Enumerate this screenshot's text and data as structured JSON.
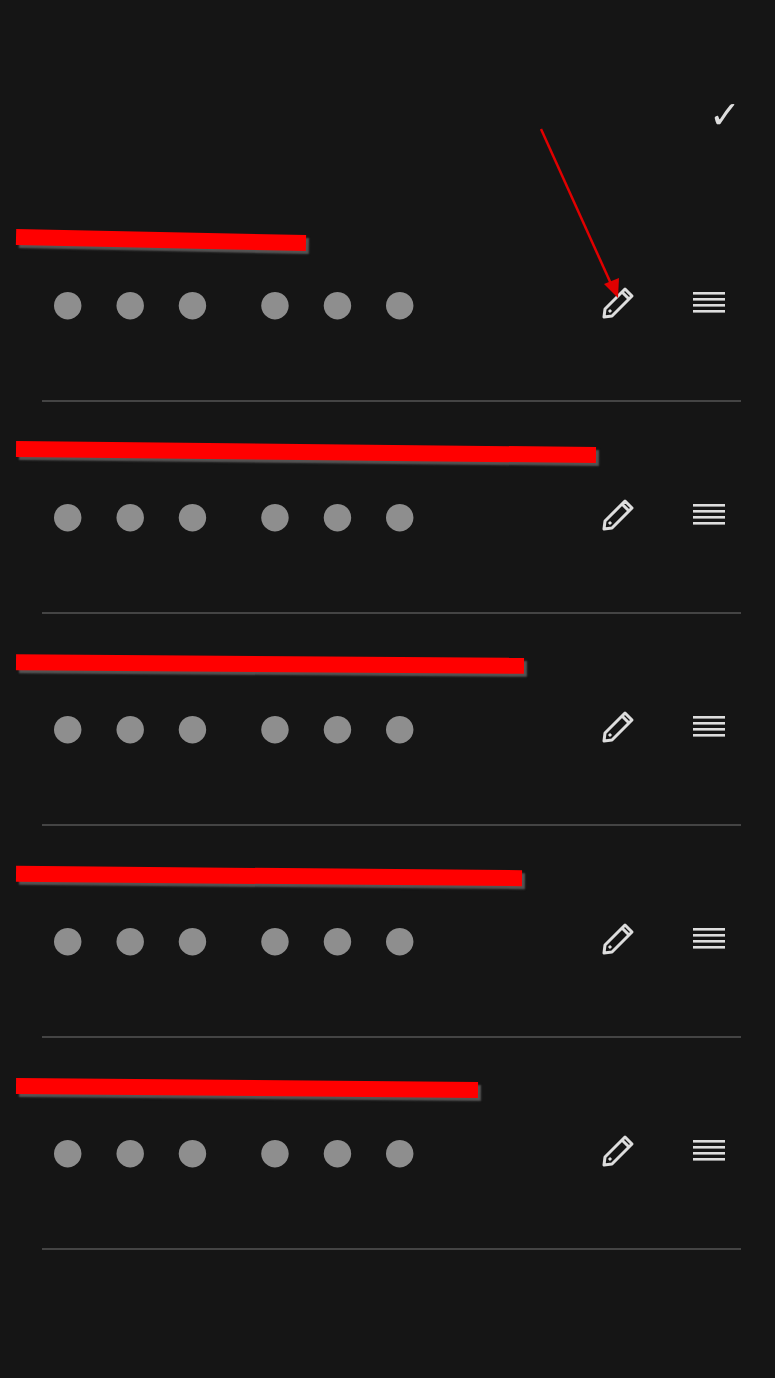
{
  "header": {
    "confirm": "✓"
  },
  "annotation": {
    "arrow": true
  },
  "accounts": [
    {
      "title_redacted": true,
      "code": [
        "●",
        "●",
        "●",
        "●",
        "●",
        "●"
      ]
    },
    {
      "title_redacted": true,
      "code": [
        "●",
        "●",
        "●",
        "●",
        "●",
        "●"
      ]
    },
    {
      "title_redacted": true,
      "code": [
        "●",
        "●",
        "●",
        "●",
        "●",
        "●"
      ]
    },
    {
      "title_redacted": true,
      "code": [
        "●",
        "●",
        "●",
        "●",
        "●",
        "●"
      ]
    },
    {
      "title_redacted": true,
      "code": [
        "●",
        "●",
        "●",
        "●",
        "●",
        "●"
      ]
    }
  ]
}
